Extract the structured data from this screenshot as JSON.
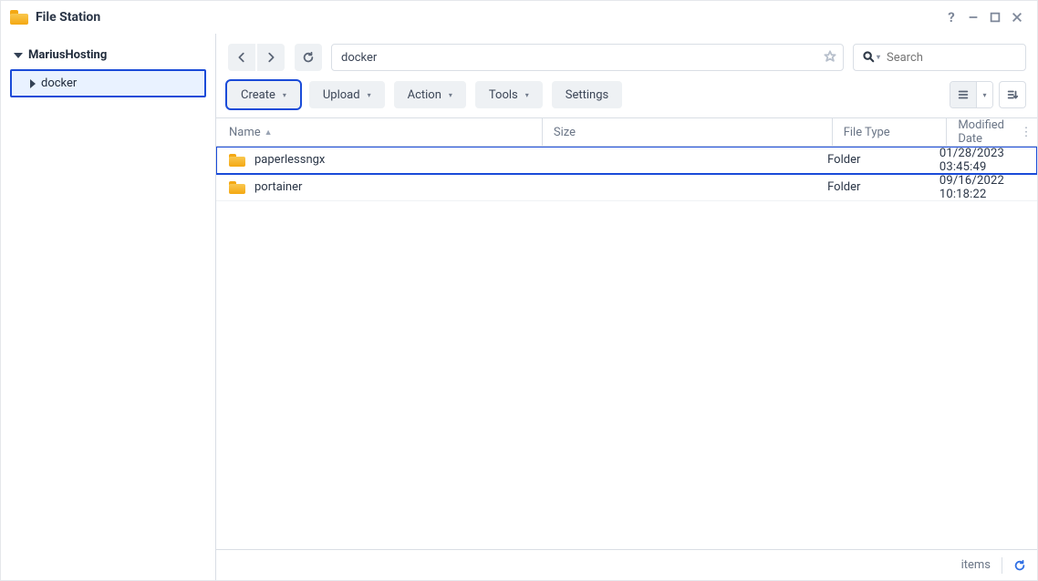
{
  "window": {
    "title": "File Station"
  },
  "sidebar": {
    "root_label": "MariusHosting",
    "items": [
      {
        "label": "docker",
        "selected": true
      }
    ]
  },
  "toolbar": {
    "path_value": "docker",
    "search_placeholder": "Search",
    "buttons": {
      "create": "Create",
      "upload": "Upload",
      "action": "Action",
      "tools": "Tools",
      "settings": "Settings"
    }
  },
  "columns": {
    "name": "Name",
    "size": "Size",
    "type": "File Type",
    "date": "Modified Date"
  },
  "rows": [
    {
      "name": "paperlessngx",
      "size": "",
      "type": "Folder",
      "date": "01/28/2023 03:45:49",
      "selected": true
    },
    {
      "name": "portainer",
      "size": "",
      "type": "Folder",
      "date": "09/16/2022 10:18:22",
      "selected": false
    }
  ],
  "status": {
    "items_label": "items"
  }
}
